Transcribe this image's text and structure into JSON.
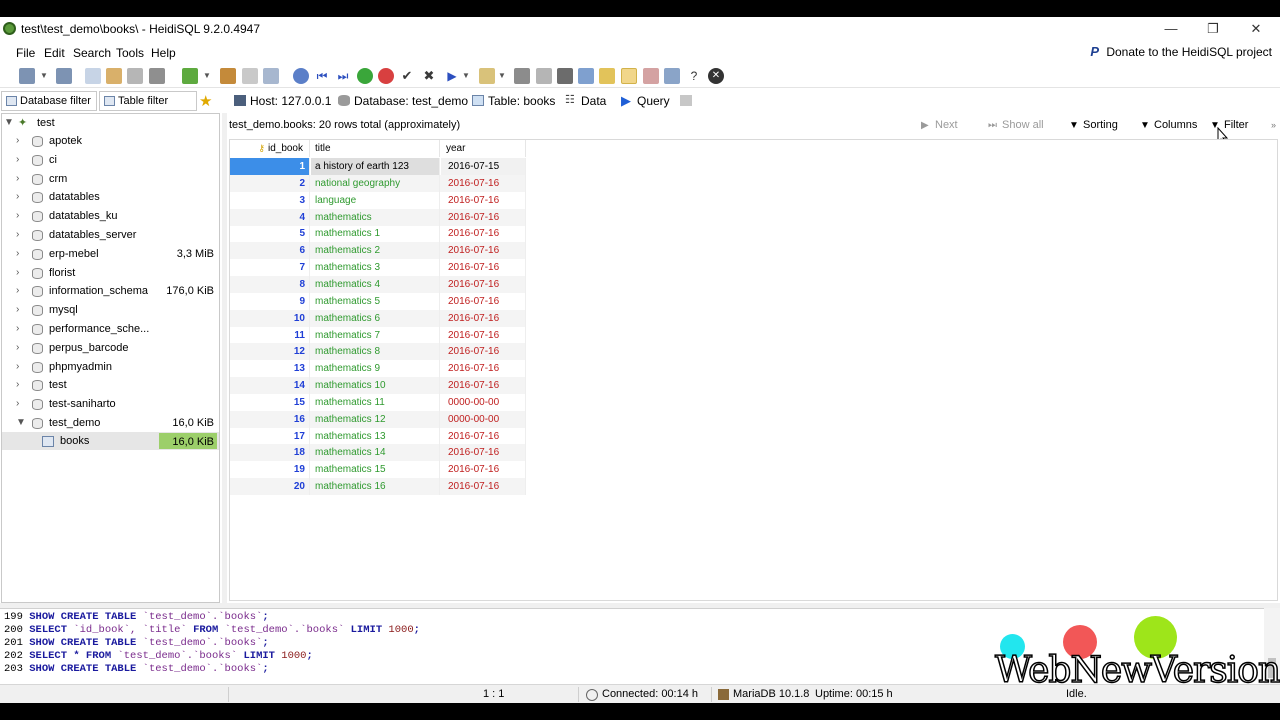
{
  "window": {
    "title": "test\\test_demo\\books\\ - HeidiSQL 9.2.0.4947",
    "minimize": "—",
    "restore": "❐",
    "close": "✕"
  },
  "menu": {
    "items": [
      "File",
      "Edit",
      "Search",
      "Tools",
      "Help"
    ],
    "donate": "Donate to the HeidiSQL project"
  },
  "left_tabs": {
    "database_filter": "Database filter",
    "table_filter": "Table filter"
  },
  "tabs": {
    "host": "Host: 127.0.0.1",
    "database": "Database: test_demo",
    "table": "Table: books",
    "data": "Data",
    "query": "Query"
  },
  "tree": {
    "root": "test",
    "items": [
      {
        "name": "apotek",
        "size": ""
      },
      {
        "name": "ci",
        "size": ""
      },
      {
        "name": "crm",
        "size": ""
      },
      {
        "name": "datatables",
        "size": ""
      },
      {
        "name": "datatables_ku",
        "size": ""
      },
      {
        "name": "datatables_server",
        "size": ""
      },
      {
        "name": "erp-mebel",
        "size": "3,3 MiB"
      },
      {
        "name": "florist",
        "size": ""
      },
      {
        "name": "information_schema",
        "size": "176,0 KiB"
      },
      {
        "name": "mysql",
        "size": ""
      },
      {
        "name": "performance_sche...",
        "size": ""
      },
      {
        "name": "perpus_barcode",
        "size": ""
      },
      {
        "name": "phpmyadmin",
        "size": ""
      },
      {
        "name": "test",
        "size": ""
      },
      {
        "name": "test-saniharto",
        "size": ""
      },
      {
        "name": "test_demo",
        "size": "16,0 KiB"
      }
    ],
    "child": {
      "name": "books",
      "size": "16,0 KiB"
    }
  },
  "data_toolbar": {
    "info": "test_demo.books: 20 rows total (approximately)",
    "next": "Next",
    "show_all": "Show all",
    "sorting": "Sorting",
    "columns": "Columns",
    "filter": "Filter"
  },
  "grid": {
    "columns": [
      "id_book",
      "title",
      "year"
    ],
    "rows": [
      [
        "1",
        "a history of earth 123",
        "2016-07-15"
      ],
      [
        "2",
        "national geography",
        "2016-07-16"
      ],
      [
        "3",
        "language",
        "2016-07-16"
      ],
      [
        "4",
        "mathematics",
        "2016-07-16"
      ],
      [
        "5",
        "mathematics 1",
        "2016-07-16"
      ],
      [
        "6",
        "mathematics 2",
        "2016-07-16"
      ],
      [
        "7",
        "mathematics 3",
        "2016-07-16"
      ],
      [
        "8",
        "mathematics 4",
        "2016-07-16"
      ],
      [
        "9",
        "mathematics 5",
        "2016-07-16"
      ],
      [
        "10",
        "mathematics 6",
        "2016-07-16"
      ],
      [
        "11",
        "mathematics 7",
        "2016-07-16"
      ],
      [
        "12",
        "mathematics 8",
        "2016-07-16"
      ],
      [
        "13",
        "mathematics 9",
        "2016-07-16"
      ],
      [
        "14",
        "mathematics 10",
        "2016-07-16"
      ],
      [
        "15",
        "mathematics 11",
        "0000-00-00"
      ],
      [
        "16",
        "mathematics 12",
        "0000-00-00"
      ],
      [
        "17",
        "mathematics 13",
        "2016-07-16"
      ],
      [
        "18",
        "mathematics 14",
        "2016-07-16"
      ],
      [
        "19",
        "mathematics 15",
        "2016-07-16"
      ],
      [
        "20",
        "mathematics 16",
        "2016-07-16"
      ]
    ]
  },
  "log": [
    {
      "n": "199",
      "parts": [
        [
          "kw",
          "SHOW CREATE TABLE "
        ],
        [
          "q",
          "`test_demo`.`books`"
        ],
        [
          "kw",
          ";"
        ]
      ]
    },
    {
      "n": "200",
      "parts": [
        [
          "kw",
          "SELECT "
        ],
        [
          "q",
          "`id_book`, `title` "
        ],
        [
          "kw",
          "FROM "
        ],
        [
          "q",
          "`test_demo`.`books` "
        ],
        [
          "kw",
          "LIMIT "
        ],
        [
          "num",
          "1000"
        ],
        [
          "kw",
          ";"
        ]
      ]
    },
    {
      "n": "201",
      "parts": [
        [
          "kw",
          "SHOW CREATE TABLE "
        ],
        [
          "q",
          "`test_demo`.`books`"
        ],
        [
          "kw",
          ";"
        ]
      ]
    },
    {
      "n": "202",
      "parts": [
        [
          "kw",
          "SELECT * FROM "
        ],
        [
          "q",
          "`test_demo`.`books` "
        ],
        [
          "kw",
          "LIMIT "
        ],
        [
          "num",
          "1000"
        ],
        [
          "kw",
          ";"
        ]
      ]
    },
    {
      "n": "203",
      "parts": [
        [
          "kw",
          "SHOW CREATE TABLE "
        ],
        [
          "q",
          "`test_demo`.`books`"
        ],
        [
          "kw",
          ";"
        ]
      ]
    }
  ],
  "status": {
    "position": "1 : 1",
    "connected": "Connected: 00:14 h",
    "server": "MariaDB 10.1.8",
    "uptime": "Uptime: 00:15 h",
    "idle": "Idle."
  },
  "watermark": "WebNewVersion",
  "colors": {
    "selection": "#3c8ee8",
    "id_text": "#1f3fd6",
    "title_text": "#2f9a2f",
    "year_text": "#c02020",
    "size_bar": "#9ccf6a"
  }
}
